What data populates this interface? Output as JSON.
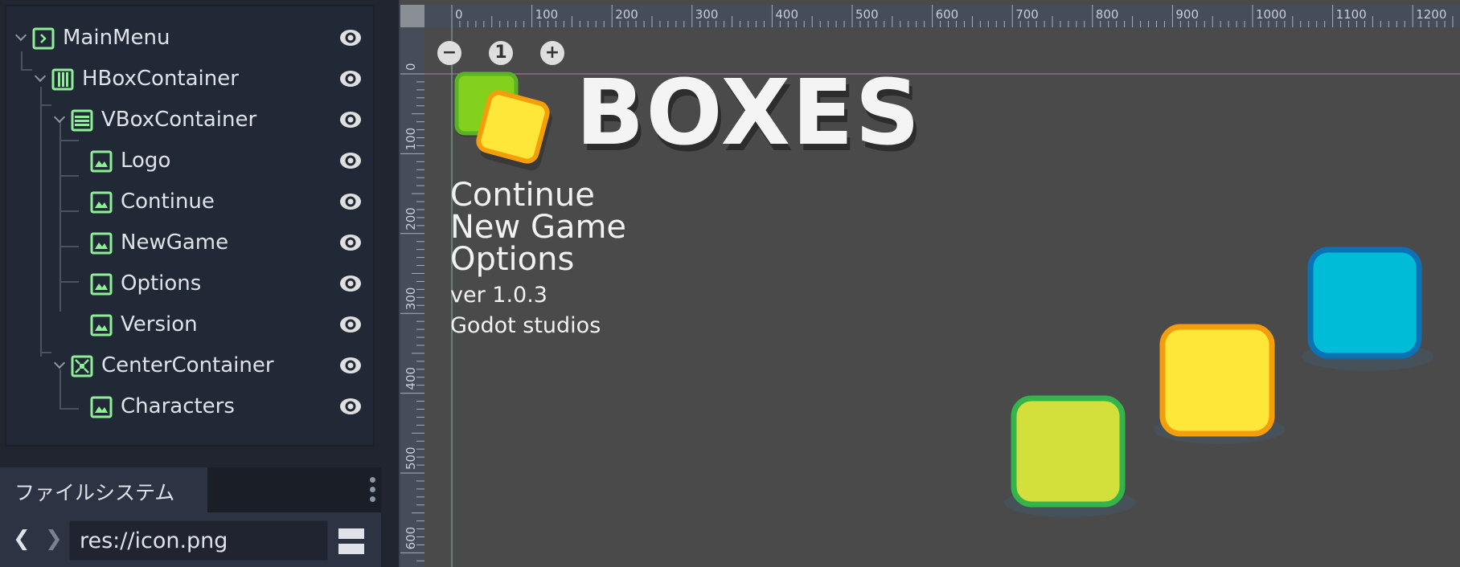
{
  "scene_tree": {
    "nodes": [
      {
        "label": "MainMenu",
        "icon": "control-icon"
      },
      {
        "label": "HBoxContainer",
        "icon": "hbox-icon"
      },
      {
        "label": "VBoxContainer",
        "icon": "vbox-icon"
      },
      {
        "label": "Logo",
        "icon": "texture-rect-icon"
      },
      {
        "label": "Continue",
        "icon": "texture-rect-icon"
      },
      {
        "label": "NewGame",
        "icon": "texture-rect-icon"
      },
      {
        "label": "Options",
        "icon": "texture-rect-icon"
      },
      {
        "label": "Version",
        "icon": "texture-rect-icon"
      },
      {
        "label": "CenterContainer",
        "icon": "center-container-icon"
      },
      {
        "label": "Characters",
        "icon": "texture-rect-icon"
      }
    ]
  },
  "filesystem": {
    "tab_label": "ファイルシステム",
    "back_glyph": "❮",
    "forward_glyph": "❯",
    "path_value": "res://icon.png"
  },
  "viewport": {
    "ruler_top_labels": [
      "0",
      "100",
      "200",
      "300",
      "400",
      "500",
      "600",
      "700",
      "800",
      "900",
      "1000",
      "1100",
      "1200"
    ],
    "ruler_left_labels": [
      "0",
      "100",
      "200",
      "300",
      "400",
      "500",
      "600"
    ],
    "zoom": {
      "minus": "−",
      "reset": "1",
      "plus": "+"
    },
    "logo_text": "BOXES",
    "menu": {
      "continue": "Continue",
      "new_game": "New Game",
      "options": "Options",
      "version": "ver 1.0.3",
      "studio": "Godot studios"
    }
  },
  "colors": {
    "node_icon": "#8eef97",
    "box_green": "#d3e03c",
    "box_yellow": "#ffe73a",
    "box_blue": "#00bcd7"
  }
}
